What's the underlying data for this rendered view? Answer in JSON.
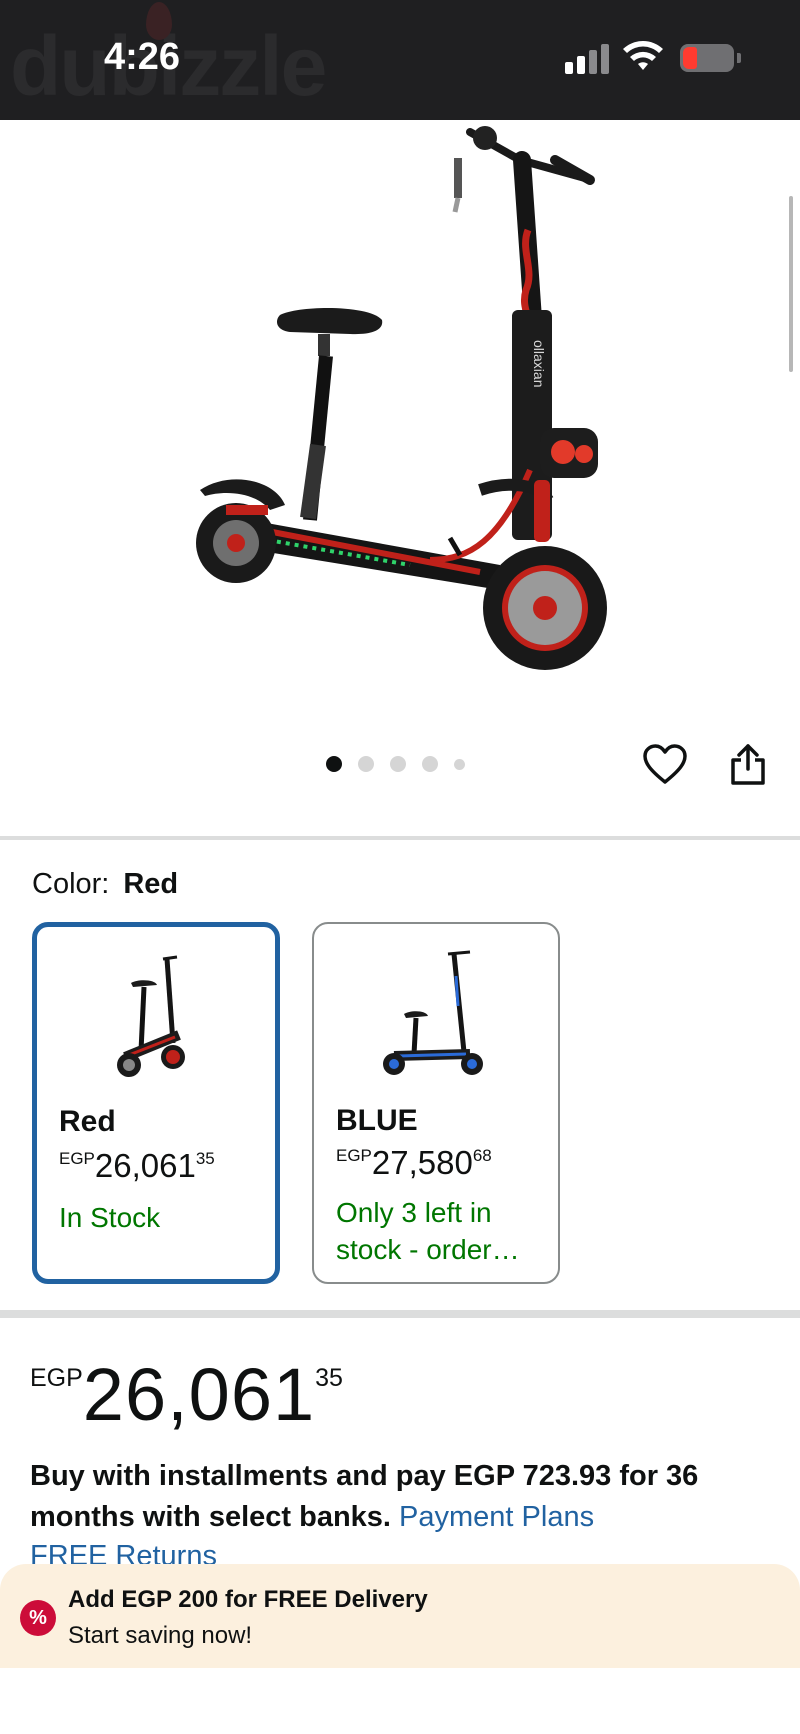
{
  "status_bar": {
    "time": "4:26",
    "watermark": "dubizzle"
  },
  "gallery": {
    "image_count": 5,
    "active_index": 0,
    "product_brand_text": "ollaxian",
    "wishlist_icon": "heart-outline-icon",
    "share_icon": "share-icon"
  },
  "color_selector": {
    "label": "Color:",
    "selected_value": "Red",
    "options": [
      {
        "name": "Red",
        "currency": "EGP",
        "price_whole": "26,061",
        "price_fraction": "35",
        "availability": "In Stock",
        "selected": true
      },
      {
        "name": "BLUE",
        "currency": "EGP",
        "price_whole": "27,580",
        "price_fraction": "68",
        "availability": "Only 3 left in stock - order…",
        "selected": false
      }
    ]
  },
  "price": {
    "currency": "EGP",
    "whole": "26,061",
    "fraction": "35"
  },
  "installments": {
    "text": "Buy with installments and pay EGP 723.93 for 36 months with select banks.",
    "link": "Payment Plans"
  },
  "free_returns": "FREE Returns",
  "promo": {
    "badge": "%",
    "title": "Add EGP 200 for FREE Delivery",
    "subtitle": "Start saving now!"
  },
  "colors": {
    "status_bar_bg": "#1f1f21",
    "selected_border": "#2162a1",
    "in_stock": "#007600",
    "link": "#2162a1",
    "promo_bg": "#fcf0de",
    "promo_badge": "#cc0c39"
  }
}
